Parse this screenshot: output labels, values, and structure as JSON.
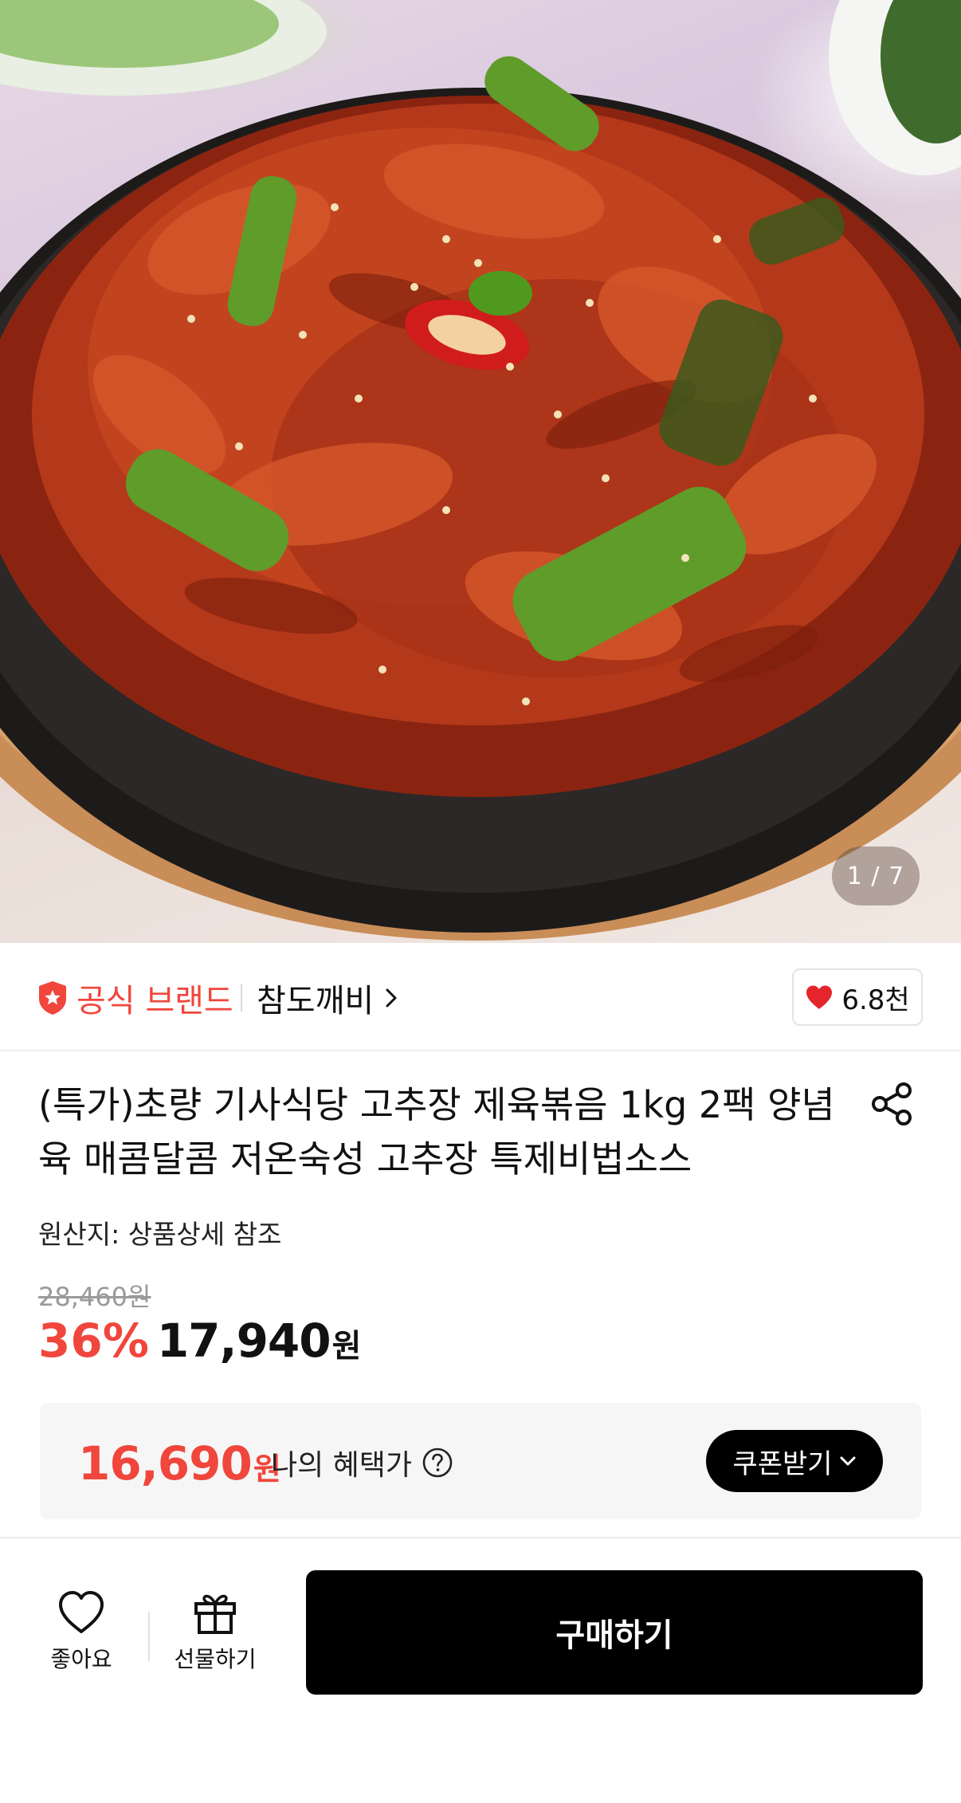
{
  "hero": {
    "image_alt": "고추장 제육볶음",
    "slide_counter": "1 / 7"
  },
  "brand": {
    "official_label": "공식 브랜드",
    "store_name": "참도깨비",
    "like_count": "6.8천",
    "accent_color": "#f0463c"
  },
  "product": {
    "title_line1": "(특가)초량 기사식당 고추장 제육볶음 1kg 2팩 양념",
    "title_line2": "육 매콤달콤 저온숙성 고추장 특제비법소스",
    "origin": "원산지: 상품상세 참조",
    "original_price": "28,460원",
    "discount": "36%",
    "sale_price": "17,940",
    "sale_unit": "원"
  },
  "benefit": {
    "amount": "16,690",
    "unit": "원",
    "label": "나의 혜택가",
    "coupon_button": "쿠폰받기"
  },
  "bottom_bar": {
    "like_label": "좋아요",
    "gift_label": "선물하기",
    "buy_label": "구매하기"
  },
  "icons": {
    "shield": "shield-star-icon",
    "heart": "heart-icon",
    "share": "share-icon",
    "help": "question-circle-icon",
    "gift": "gift-icon"
  }
}
